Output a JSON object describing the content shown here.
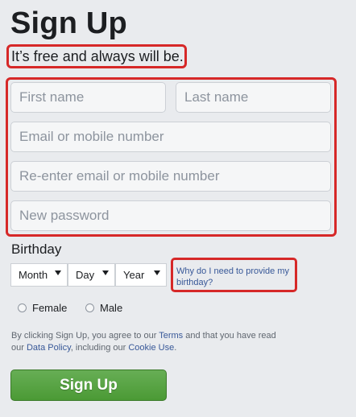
{
  "header": {
    "title": "Sign Up",
    "tagline": "It’s free and always will be."
  },
  "form": {
    "first_name_placeholder": "First name",
    "last_name_placeholder": "Last name",
    "email_placeholder": "Email or mobile number",
    "email_confirm_placeholder": "Re-enter email or mobile number",
    "password_placeholder": "New password"
  },
  "birthday": {
    "label": "Birthday",
    "month": "Month",
    "day": "Day",
    "year": "Year",
    "why_link": "Why do I need to provide my birthday?"
  },
  "gender": {
    "female": "Female",
    "male": "Male"
  },
  "terms": {
    "part1": "By clicking Sign Up, you agree to our ",
    "terms_link": "Terms",
    "part2": " and that you have read our ",
    "data_policy_link": "Data Policy",
    "part3": ", including our ",
    "cookie_link": "Cookie Use",
    "part4": "."
  },
  "submit": {
    "label": "Sign Up"
  },
  "colors": {
    "highlight": "#d62828",
    "link": "#385898",
    "button_green": "#4b9a35"
  }
}
